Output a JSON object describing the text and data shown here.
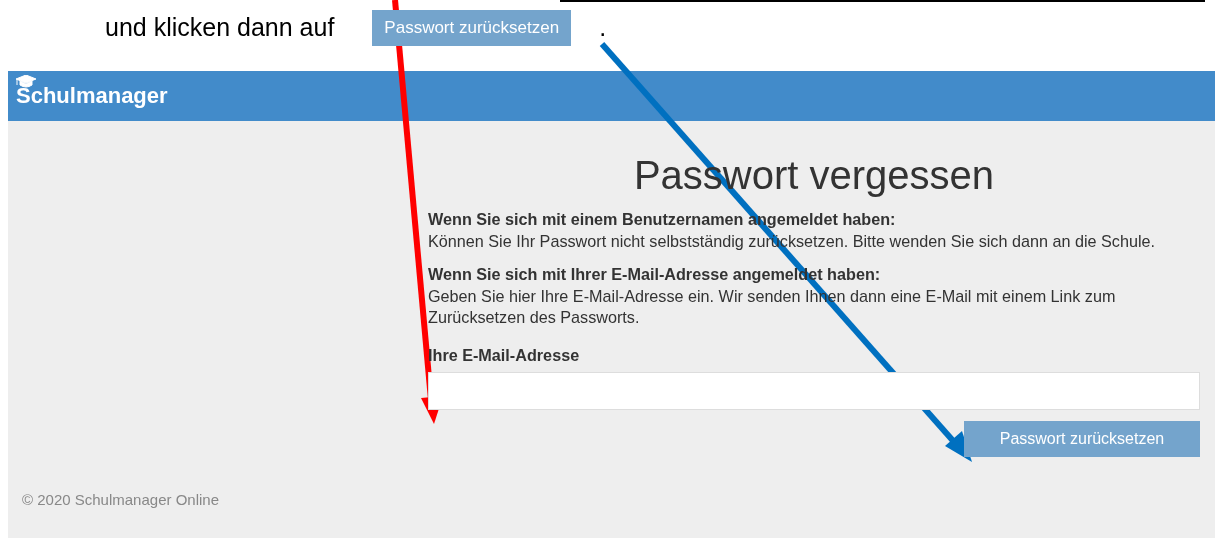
{
  "instruction": {
    "text": "und klicken dann auf",
    "button": "Passwort zurücksetzen",
    "end": "."
  },
  "app": {
    "brand": "Schulmanager",
    "title": "Passwort vergessen",
    "sections": [
      {
        "heading": "Wenn Sie sich mit einem Benutzernamen angemeldet haben:",
        "text": "Können Sie Ihr Passwort nicht selbstständig zurücksetzen. Bitte wenden Sie sich dann an die Schule."
      },
      {
        "heading": "Wenn Sie sich mit Ihrer E-Mail-Adresse angemeldet haben:",
        "text": "Geben Sie hier Ihre E-Mail-Adresse ein. Wir senden Ihnen dann eine E-Mail mit einem Link zum Zurücksetzen des Passworts."
      }
    ],
    "field_label": "Ihre E-Mail-Adresse",
    "button": "Passwort zurücksetzen",
    "footer": "© 2020 Schulmanager Online"
  }
}
